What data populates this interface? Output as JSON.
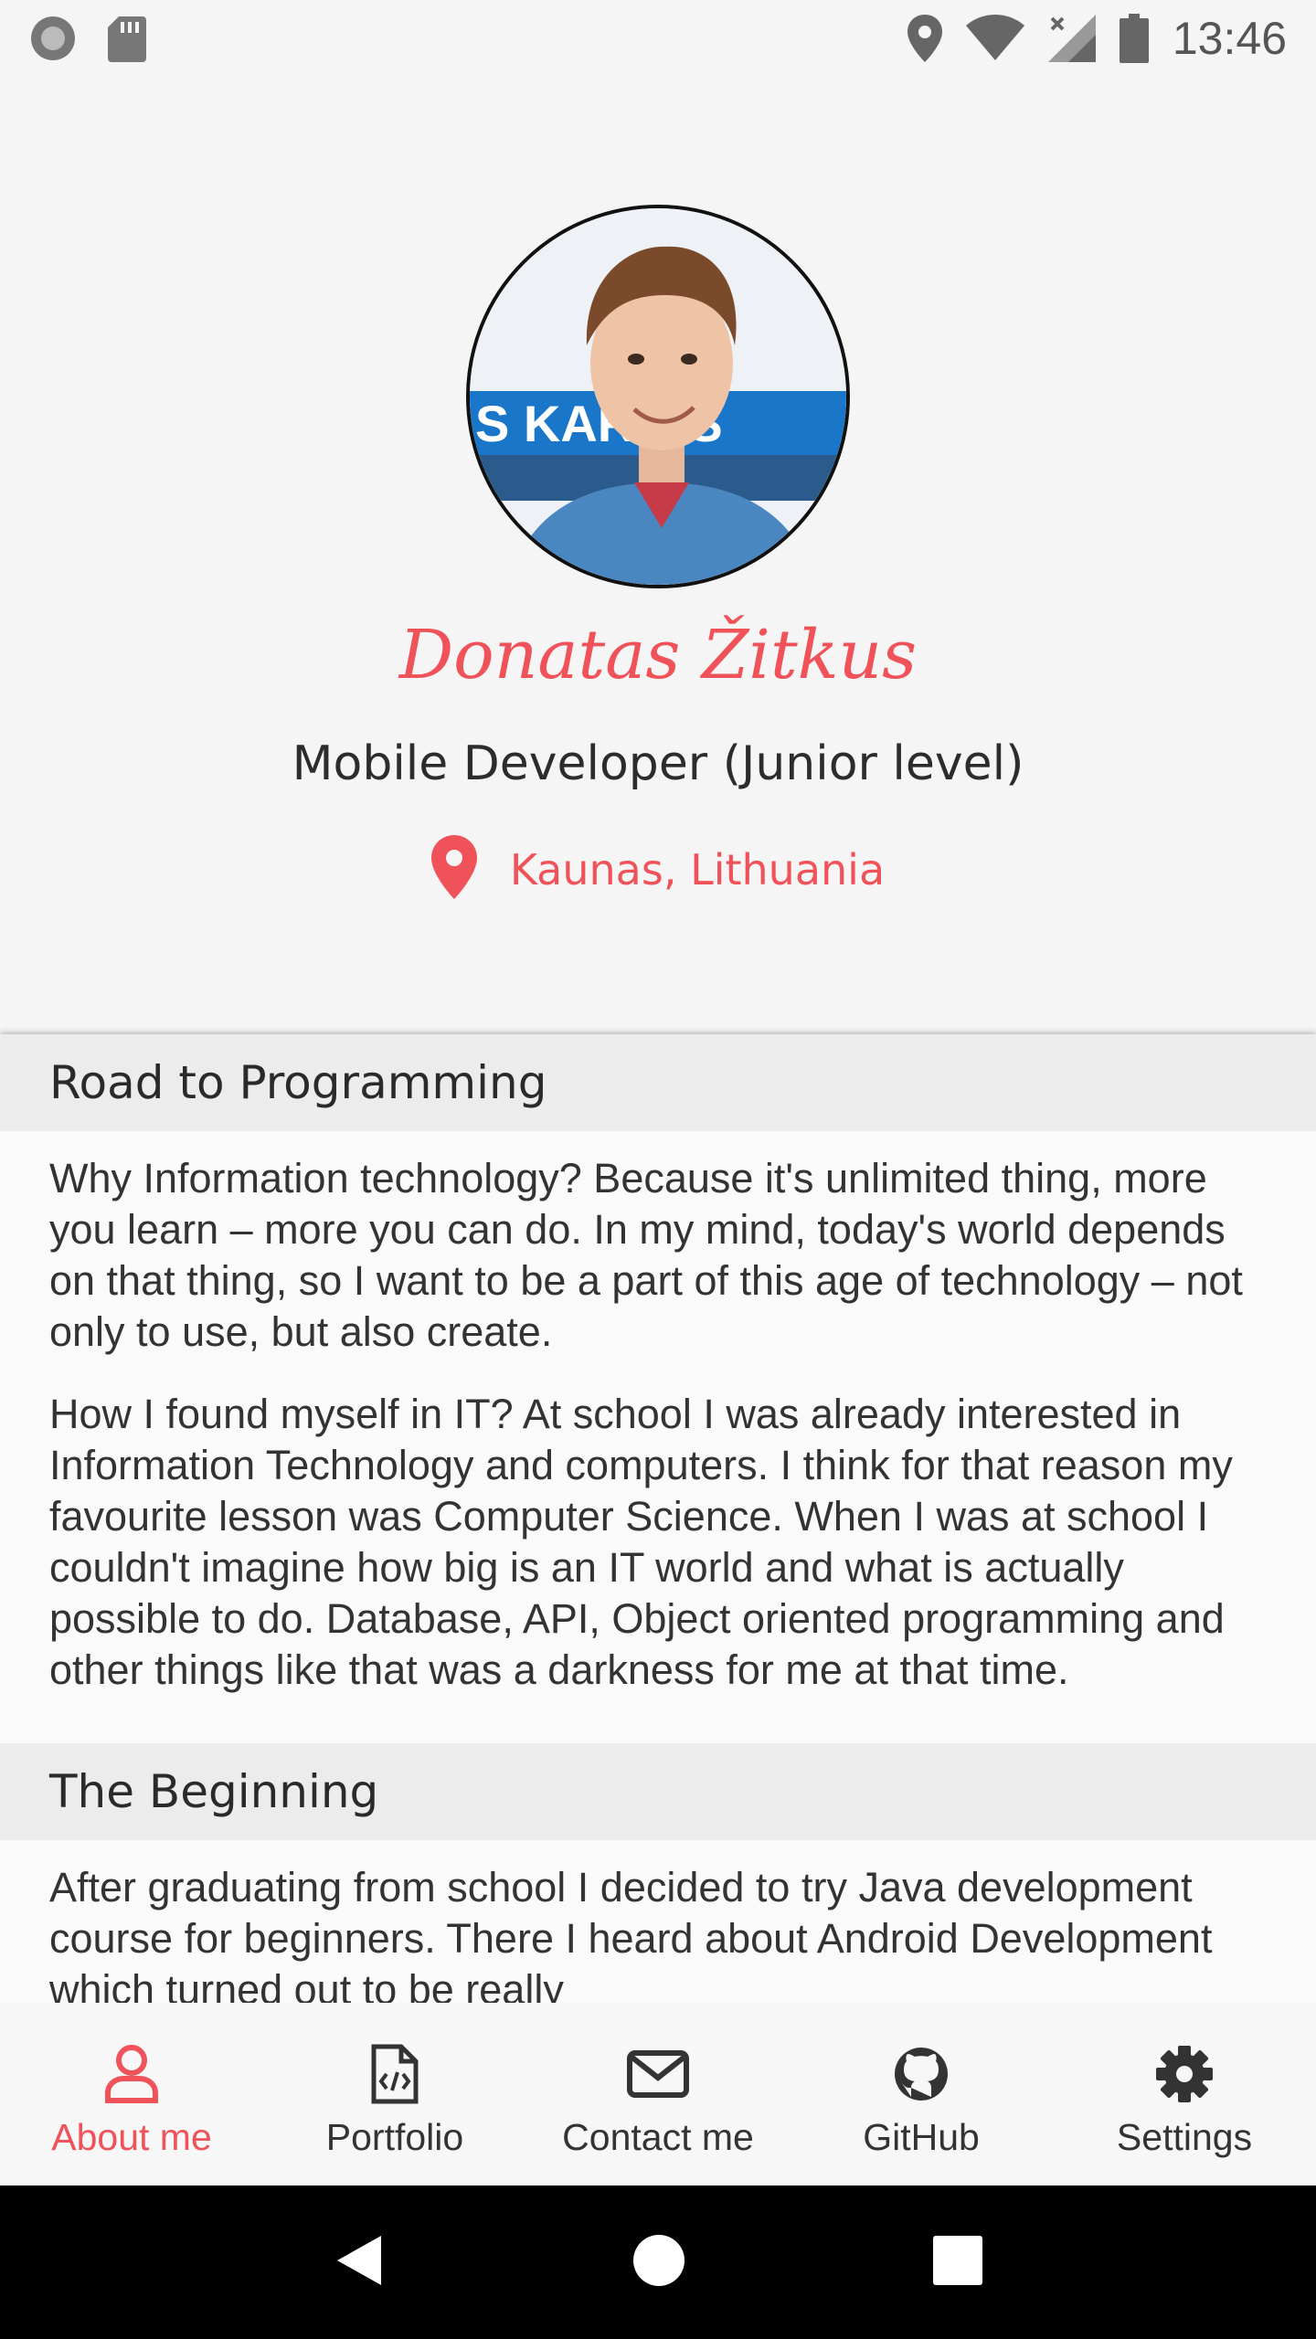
{
  "status_bar": {
    "time": "13:46",
    "icons": [
      "record-icon",
      "sd-card-icon",
      "location-icon",
      "wifi-icon",
      "cellular-icon",
      "battery-icon"
    ]
  },
  "profile": {
    "name": "Donatas Žitkus",
    "role": "Mobile Developer (Junior level)",
    "location": "Kaunas, Lithuania",
    "avatar_sign_text": "S KAR  OS",
    "accent_color": "#f0525a"
  },
  "sections": [
    {
      "title": "Road to Programming",
      "paragraphs": [
        "Why Information technology? Because it's unlimited thing, more you learn – more you can do. In my mind, today's world depends on that thing, so I want to be a part of this age of technology – not only to use, but also create.",
        "How I found myself in IT? At school I was already interested in Information Technology and computers. I think for that reason my favourite lesson was Computer Science. When I was at school I couldn't imagine how big is an IT world and what is actually possible to do. Database, API, Object oriented programming and other things like that was a darkness for me at that time."
      ]
    },
    {
      "title": "The Beginning",
      "paragraphs": [
        "After graduating from school I decided to try Java development course for beginners. There I heard about Android Development which turned out to be really"
      ]
    }
  ],
  "bottom_nav": {
    "items": [
      {
        "label": "About me",
        "icon": "user-icon",
        "active": true
      },
      {
        "label": "Portfolio",
        "icon": "code-file-icon",
        "active": false
      },
      {
        "label": "Contact me",
        "icon": "envelope-icon",
        "active": false
      },
      {
        "label": "GitHub",
        "icon": "github-icon",
        "active": false
      },
      {
        "label": "Settings",
        "icon": "gear-icon",
        "active": false
      }
    ]
  },
  "system_nav": {
    "icons": [
      "back-icon",
      "home-icon",
      "recents-icon"
    ]
  }
}
